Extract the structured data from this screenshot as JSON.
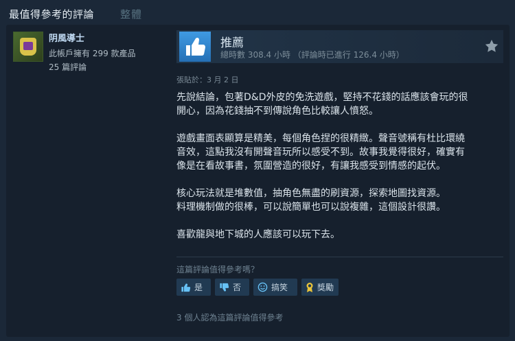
{
  "tabs": {
    "active": "最值得參考的評論",
    "inactive": "整體"
  },
  "reviewer": {
    "name": "阴風導士",
    "owned_games": "此帳戶擁有 299 款產品",
    "review_count": "25 篇評論"
  },
  "review": {
    "verdict": "推薦",
    "playtime": "總時數 308.4 小時 （評論時已進行 126.4 小時）",
    "posted": "張貼於：3 月 2 日",
    "paragraphs": [
      [
        "先說結論，包著D&D外皮的免洗遊戲，堅持不花錢的話應該會玩的很",
        "開心，因為花錢抽不到傳說角色比較讓人憤怒。"
      ],
      [
        "遊戲畫面表顯算是精美，每個角色捏的很精緻。聲音號稱有杜比環繞",
        "音效，這點我沒有開聲音玩所以感受不到。故事我覺得很好，確實有",
        "像是在看故事書，氛圍營造的很好，有讓我感受到情感的起伏。"
      ],
      [
        "核心玩法就是堆數值，抽角色無盡的刷資源，探索地圖找資源。",
        "料理機制做的很棒，可以說簡單也可以說複雜，這個設計很讚。"
      ],
      [
        "喜歡龍與地下城的人應該可以玩下去。"
      ]
    ]
  },
  "helpful": {
    "question": "這篇評論值得參考嗎？",
    "yes": "是",
    "no": "否",
    "funny": "搞笑",
    "award": "獎勵",
    "count_text": "3 個人認為這篇評論值得參考"
  },
  "colors": {
    "background": "#1b2838",
    "panel": "#16202d",
    "accent_blue": "#2a7ec7",
    "button": "#213a52",
    "award_gold": "#e8c33a"
  },
  "icons": [
    "thumbs-up-icon",
    "star-icon",
    "thumbs-down-icon",
    "smile-icon",
    "award-icon"
  ]
}
